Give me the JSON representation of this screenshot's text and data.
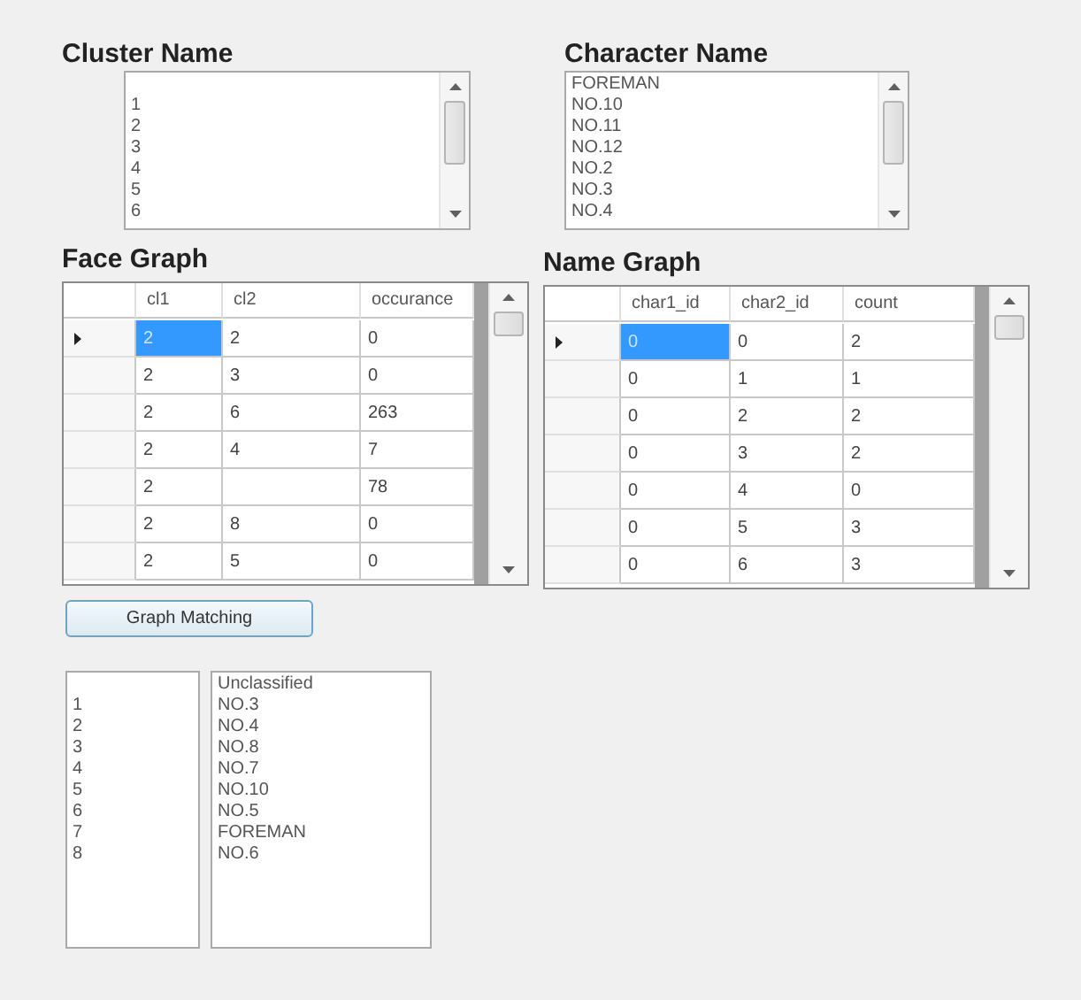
{
  "cluster_name": {
    "title": "Cluster Name",
    "items": [
      "1",
      "2",
      "3",
      "4",
      "5",
      "6"
    ]
  },
  "character_name": {
    "title": "Character Name",
    "items": [
      "FOREMAN",
      "NO.10",
      "NO.11",
      "NO.12",
      "NO.2",
      "NO.3",
      "NO.4"
    ]
  },
  "face_graph": {
    "title": "Face Graph",
    "columns": [
      "cl1",
      "cl2",
      "occurance"
    ],
    "rows": [
      {
        "cells": [
          "2",
          "2",
          "0"
        ],
        "selected": true
      },
      {
        "cells": [
          "2",
          "3",
          "0"
        ],
        "selected": false
      },
      {
        "cells": [
          "2",
          "6",
          "263"
        ],
        "selected": false
      },
      {
        "cells": [
          "2",
          "4",
          "7"
        ],
        "selected": false
      },
      {
        "cells": [
          "2",
          null,
          "78"
        ],
        "selected": false
      },
      {
        "cells": [
          "2",
          "8",
          "0"
        ],
        "selected": false
      },
      {
        "cells": [
          "2",
          "5",
          "0"
        ],
        "selected": false
      }
    ]
  },
  "name_graph": {
    "title": "Name Graph",
    "columns": [
      "char1_id",
      "char2_id",
      "count"
    ],
    "rows": [
      {
        "cells": [
          "0",
          "0",
          "2"
        ],
        "selected": true
      },
      {
        "cells": [
          "0",
          "1",
          "1"
        ],
        "selected": false
      },
      {
        "cells": [
          "0",
          "2",
          "2"
        ],
        "selected": false
      },
      {
        "cells": [
          "0",
          "3",
          "2"
        ],
        "selected": false
      },
      {
        "cells": [
          "0",
          "4",
          "0"
        ],
        "selected": false
      },
      {
        "cells": [
          "0",
          "5",
          "3"
        ],
        "selected": false
      },
      {
        "cells": [
          "0",
          "6",
          "3"
        ],
        "selected": false
      }
    ]
  },
  "button": "Graph Matching",
  "results": {
    "clusters": [
      "1",
      "2",
      "3",
      "4",
      "5",
      "6",
      "7",
      "8"
    ],
    "names": [
      "Unclassified",
      "NO.3",
      "NO.4",
      "NO.8",
      "NO.7",
      "NO.10",
      "NO.5",
      "FOREMAN",
      "NO.6"
    ]
  }
}
